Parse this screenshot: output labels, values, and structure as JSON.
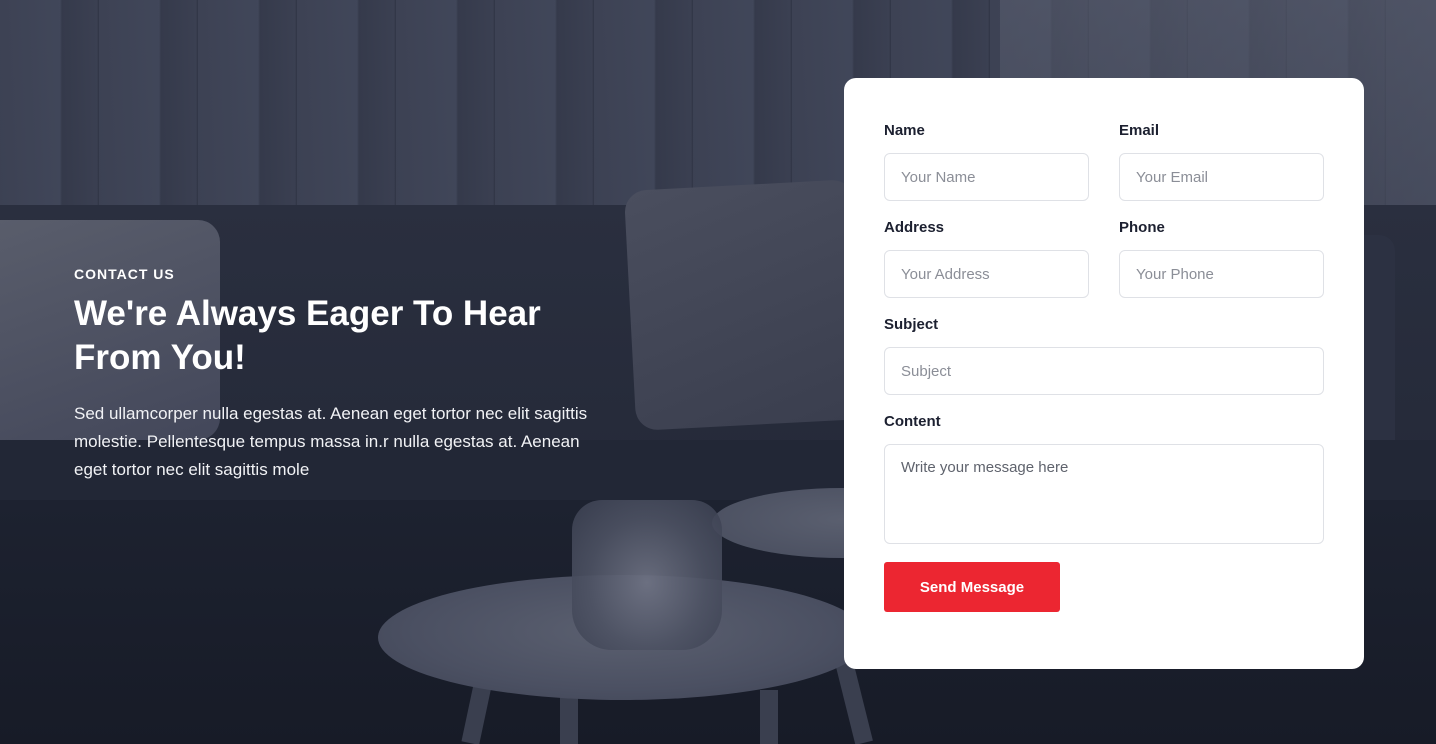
{
  "intro": {
    "eyebrow": "CONTACT US",
    "headline": "We're Always Eager To Hear From You!",
    "lead": "Sed ullamcorper nulla egestas at. Aenean eget tortor nec elit sagittis molestie. Pellentesque tempus massa in.r nulla egestas at. Aenean eget tortor nec elit sagittis mole"
  },
  "form": {
    "name": {
      "label": "Name",
      "placeholder": "Your Name"
    },
    "email": {
      "label": "Email",
      "placeholder": "Your Email"
    },
    "address": {
      "label": "Address",
      "placeholder": "Your Address"
    },
    "phone": {
      "label": "Phone",
      "placeholder": "Your Phone"
    },
    "subject": {
      "label": "Subject",
      "placeholder": "Subject"
    },
    "content": {
      "label": "Content",
      "placeholder": "Write your message here"
    },
    "submit_label": "Send Message"
  },
  "colors": {
    "accent": "#ec2631",
    "overlay": "#1b2030",
    "card": "#ffffff"
  }
}
